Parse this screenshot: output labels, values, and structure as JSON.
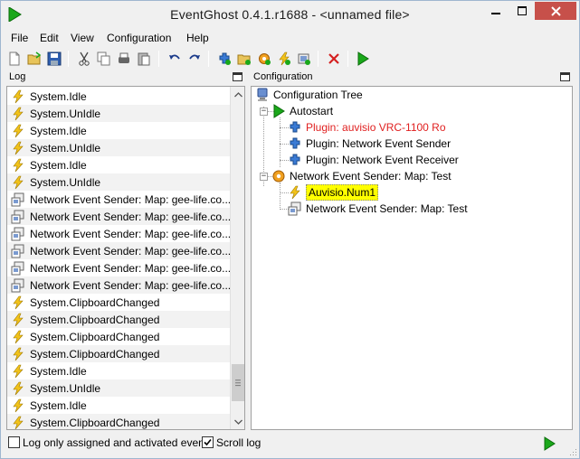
{
  "window": {
    "title": "EventGhost 0.4.1.r1688 - <unnamed file>",
    "app_icon": "play-icon",
    "controls": [
      "minimize-icon",
      "maximize-icon",
      "close-icon"
    ]
  },
  "menu": [
    "File",
    "Edit",
    "View",
    "Configuration",
    "Help"
  ],
  "toolbar": {
    "buttons": [
      "new-file-icon",
      "open-folder-icon",
      "save-icon",
      "cut-icon",
      "copy-icon",
      "python-icon",
      "paste-icon",
      "undo-icon",
      "redo-icon",
      "add-plugin-icon",
      "add-folder-icon",
      "add-macro-icon",
      "add-event-icon",
      "add-action-icon",
      "delete-icon",
      "execute-icon"
    ]
  },
  "log": {
    "header": "Log",
    "rows": [
      {
        "icon": "event-icon",
        "text": "System.Idle"
      },
      {
        "icon": "event-icon",
        "text": "System.UnIdle"
      },
      {
        "icon": "event-icon",
        "text": "System.Idle"
      },
      {
        "icon": "event-icon",
        "text": "System.UnIdle"
      },
      {
        "icon": "event-icon",
        "text": "System.Idle"
      },
      {
        "icon": "event-icon",
        "text": "System.UnIdle"
      },
      {
        "icon": "network-icon",
        "text": "Network Event Sender: Map: gee-life.co..."
      },
      {
        "icon": "network-icon",
        "text": "Network Event Sender: Map: gee-life.co..."
      },
      {
        "icon": "network-icon",
        "text": "Network Event Sender: Map: gee-life.co..."
      },
      {
        "icon": "network-icon",
        "text": "Network Event Sender: Map: gee-life.co..."
      },
      {
        "icon": "network-icon",
        "text": "Network Event Sender: Map: gee-life.co..."
      },
      {
        "icon": "network-icon",
        "text": "Network Event Sender: Map: gee-life.co..."
      },
      {
        "icon": "event-icon",
        "text": "System.ClipboardChanged"
      },
      {
        "icon": "event-icon",
        "text": "System.ClipboardChanged"
      },
      {
        "icon": "event-icon",
        "text": "System.ClipboardChanged"
      },
      {
        "icon": "event-icon",
        "text": "System.ClipboardChanged"
      },
      {
        "icon": "event-icon",
        "text": "System.Idle"
      },
      {
        "icon": "event-icon",
        "text": "System.UnIdle"
      },
      {
        "icon": "event-icon",
        "text": "System.Idle"
      },
      {
        "icon": "event-icon",
        "text": "System.ClipboardChanged"
      }
    ],
    "scroll": {
      "thumb_start": 0.84,
      "thumb_end": 0.96
    }
  },
  "config": {
    "header": "Configuration",
    "tree": {
      "root": "Configuration Tree",
      "autostart": "Autostart",
      "plugins": [
        {
          "text": "Plugin: auvisio VRC-1100 Ro",
          "color": "#e02020"
        },
        {
          "text": "Plugin: Network Event Sender",
          "color": "#000000"
        },
        {
          "text": "Plugin: Network Event Receiver",
          "color": "#000000"
        }
      ],
      "macro": "Network Event Sender: Map: Test",
      "event": "Auvisio.Num1",
      "action": "Network Event Sender: Map: Test"
    }
  },
  "status": {
    "log_only_label": "Log only assigned and activated events",
    "log_only_checked": false,
    "scroll_log_label": "Scroll log",
    "scroll_log_checked": true,
    "run_icon": "play-icon"
  },
  "colors": {
    "highlight": "#ffff00",
    "play_green": "#1aa81a",
    "event_yellow": "#f2c31a",
    "close_red": "#c7504a"
  }
}
